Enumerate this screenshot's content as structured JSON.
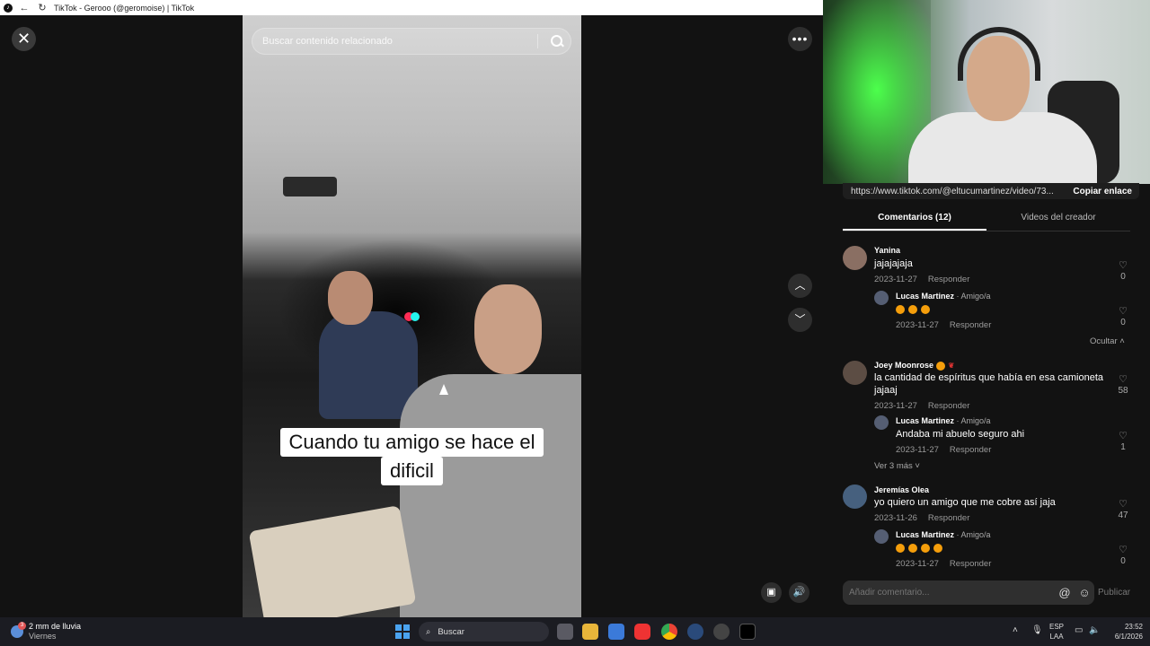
{
  "browser": {
    "title": "TikTok - Gerooo (@geromoise) | TikTok"
  },
  "viewer": {
    "search_placeholder": "Buscar contenido relacionado",
    "caption_line1": "Cuando tu amigo se hace el",
    "caption_line2": "dificil"
  },
  "panel": {
    "url": "https://www.tiktok.com/@eltucumartinez/video/73...",
    "copy_label": "Copiar enlace",
    "tabs": [
      {
        "label": "Comentarios (12)",
        "active": true
      },
      {
        "label": "Videos del creador",
        "active": false
      }
    ],
    "comments": [
      {
        "author": "Yanina",
        "text": "jajajajaja",
        "date": "2023-11-27",
        "reply_label": "Responder",
        "likes": "0"
      },
      {
        "author": "Lucas Martinez",
        "tag": " · Amigo/a",
        "text": "",
        "date": "2023-11-27",
        "reply_label": "Responder",
        "likes": "0"
      },
      {
        "toggle": "Ocultar"
      },
      {
        "author": "Joey Moonrose",
        "text_line1": "la cantidad de espíritus que había en esa camioneta",
        "text_line2": "jajaaj",
        "date": "2023-11-27",
        "reply_label": "Responder",
        "likes": "58"
      },
      {
        "author": "Lucas Martinez",
        "tag": " · Amigo/a",
        "text": "Andaba mi abuelo seguro ahi",
        "date": "2023-11-27",
        "reply_label": "Responder",
        "likes": "1"
      },
      {
        "toggle": "Ver 3 más"
      },
      {
        "author": "Jeremías Olea",
        "text": "yo quiero un amigo que me cobre así jaja",
        "date": "2023-11-26",
        "reply_label": "Responder",
        "likes": "47"
      },
      {
        "author": "Lucas Martinez",
        "tag": " · Amigo/a",
        "text": "",
        "date": "2023-11-27",
        "reply_label": "Responder",
        "likes": "0"
      }
    ],
    "composer_placeholder": "Añadir comentario...",
    "post_label": "Publicar"
  },
  "taskbar": {
    "weather_line1": "2 mm de lluvia",
    "weather_line2": "Viernes",
    "weather_badge": "3",
    "search_label": "Buscar",
    "lang_line1": "ESP",
    "lang_line2": "LAA",
    "time": "23:52",
    "date": "6/1/2026"
  },
  "colors": {
    "background": "#121212",
    "tiktok_red": "#fe2c55",
    "tiktok_cyan": "#25f4ee"
  }
}
